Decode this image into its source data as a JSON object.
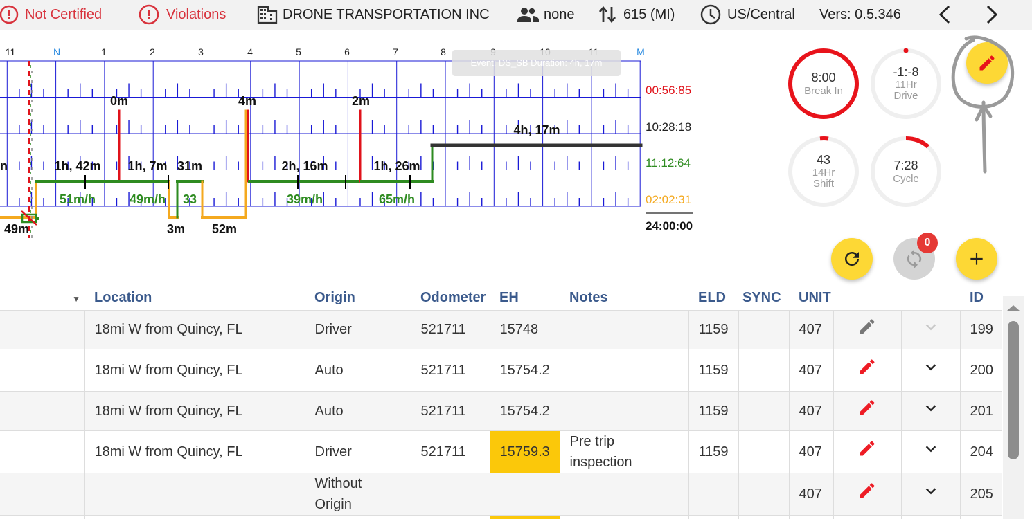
{
  "header": {
    "not_certified": "Not Certified",
    "violations": "Violations",
    "company": "DRONE TRANSPORTATION INC",
    "codriver": "none",
    "distance": "615 (MI)",
    "timezone": "US/Central",
    "version": "Vers: 0.5.346"
  },
  "tooltip": "Event: DS_SB Duration: 4h, 17m",
  "graph": {
    "hour_labels": [
      "11",
      "N",
      "1",
      "2",
      "3",
      "4",
      "5",
      "6",
      "7",
      "8",
      "9",
      "10",
      "11",
      "M"
    ],
    "totals": {
      "off": "00:56:85",
      "sleeper": "10:28:18",
      "driving": "11:12:64",
      "on_duty": "02:02:31",
      "total": "24:00:00"
    },
    "duration_labels": [
      "0m",
      "4m",
      "2m",
      "4h, 17m",
      "1h, 42m",
      "1h, 7m",
      "31m",
      "2h, 16m",
      "1h, 26m",
      "49m",
      "3m",
      "52m"
    ],
    "speed_labels": [
      "51m/h",
      "49m/h",
      "33",
      "39m/h",
      "65m/h"
    ],
    "left_cut": "n"
  },
  "gauges": {
    "break": {
      "value": "8:00",
      "label": "Break In"
    },
    "drive": {
      "value": "-1:-8",
      "label1": "11Hr",
      "label2": "Drive"
    },
    "shift": {
      "value": "43",
      "label1": "14Hr",
      "label2": "Shift"
    },
    "cycle": {
      "value": "7:28",
      "label": "Cycle"
    }
  },
  "sync_badge": "0",
  "columns": [
    "Location",
    "Origin",
    "Odometer",
    "EH",
    "Notes",
    "ELD",
    "SYNC",
    "UNIT",
    "ID"
  ],
  "rows": [
    {
      "location": "18mi W from Quincy, FL",
      "origin": "Driver",
      "odometer": "521711",
      "eh": "15748",
      "notes": "",
      "eld": "1159",
      "sync": "",
      "unit": "407",
      "id": "199"
    },
    {
      "location": "18mi W from Quincy, FL",
      "origin": "Auto",
      "odometer": "521711",
      "eh": "15754.2",
      "notes": "",
      "eld": "1159",
      "sync": "",
      "unit": "407",
      "id": "200"
    },
    {
      "location": "18mi W from Quincy, FL",
      "origin": "Auto",
      "odometer": "521711",
      "eh": "15754.2",
      "notes": "",
      "eld": "1159",
      "sync": "",
      "unit": "407",
      "id": "201"
    },
    {
      "location": "18mi W from Quincy, FL",
      "origin": "Driver",
      "odometer": "521711",
      "eh": "15759.3",
      "notes": "Pre trip inspection",
      "eld": "1159",
      "sync": "",
      "unit": "407",
      "id": "204"
    },
    {
      "location": "",
      "origin": "Without Origin",
      "odometer": "",
      "eh": "",
      "notes": "",
      "eld": "",
      "sync": "",
      "unit": "407",
      "id": "205"
    }
  ],
  "colors": {
    "off": "#e0131b",
    "driving": "#2e8b20",
    "on_duty": "#f4a91f",
    "sleeper": "#333333",
    "grid": "#1a1ad6",
    "accent": "#fdd835"
  }
}
